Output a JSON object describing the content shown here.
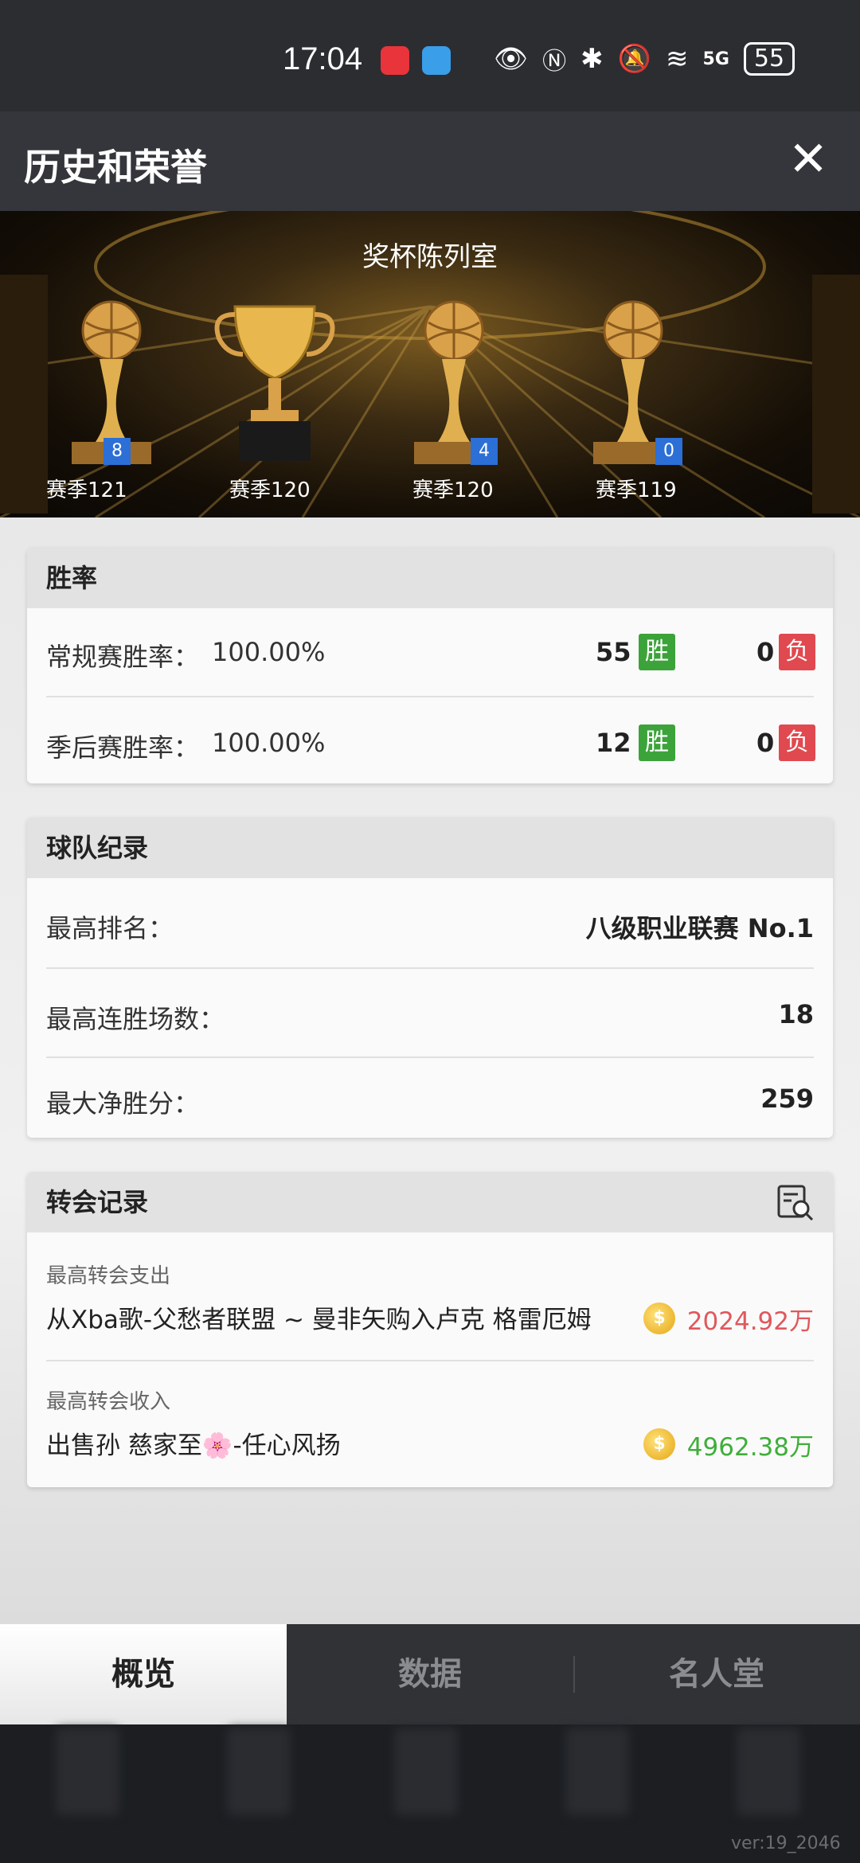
{
  "status_bar": {
    "time": "17:04",
    "battery": "55",
    "network": "5G"
  },
  "header": {
    "title": "历史和荣誉"
  },
  "trophy_room": {
    "title": "奖杯陈列室",
    "trophies": [
      {
        "label": "赛季121",
        "badge": "8",
        "type": "basketball"
      },
      {
        "label": "赛季120",
        "badge": "",
        "type": "cup"
      },
      {
        "label": "赛季120",
        "badge": "4",
        "type": "basketball"
      },
      {
        "label": "赛季119",
        "badge": "0",
        "type": "basketball"
      }
    ]
  },
  "win_rate": {
    "title": "胜率",
    "rows": [
      {
        "label": "常规赛胜率：",
        "value": "100.00%",
        "wins": "55",
        "win_tag": "胜",
        "losses": "0",
        "loss_tag": "负"
      },
      {
        "label": "季后赛胜率：",
        "value": "100.00%",
        "wins": "12",
        "win_tag": "胜",
        "losses": "0",
        "loss_tag": "负"
      }
    ]
  },
  "team_record": {
    "title": "球队纪录",
    "rows": [
      {
        "label": "最高排名：",
        "value": "八级职业联赛 No.1"
      },
      {
        "label": "最高连胜场数：",
        "value": "18"
      },
      {
        "label": "最大净胜分：",
        "value": "259"
      }
    ]
  },
  "transfer_record": {
    "title": "转会记录",
    "rows": [
      {
        "label": "最高转会支出",
        "detail": "从Xba歌-父愁者联盟 ~ 曼非矢购入卢克 格雷厄姆",
        "amount": "2024.92万",
        "color": "#e0585c"
      },
      {
        "label": "最高转会收入",
        "detail": "出售孙 慈家至🌸-任心风扬",
        "amount": "4962.38万",
        "color": "#3fae3a"
      }
    ]
  },
  "tabs": [
    {
      "label": "概览",
      "active": true
    },
    {
      "label": "数据",
      "active": false
    },
    {
      "label": "名人堂",
      "active": false
    }
  ],
  "version": "ver:19_2046"
}
